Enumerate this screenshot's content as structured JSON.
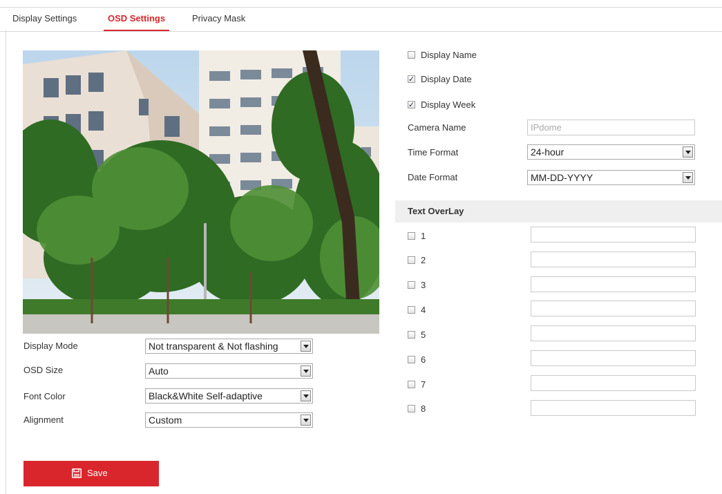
{
  "tabs": [
    {
      "label": "Display Settings",
      "active": false
    },
    {
      "label": "OSD Settings",
      "active": true
    },
    {
      "label": "Privacy Mask",
      "active": false
    }
  ],
  "left_form": {
    "display_mode": {
      "label": "Display Mode",
      "value": "Not transparent & Not flashing"
    },
    "osd_size": {
      "label": "OSD Size",
      "value": "Auto"
    },
    "font_color": {
      "label": "Font Color",
      "value": "Black&White Self-adaptive"
    },
    "alignment": {
      "label": "Alignment",
      "value": "Custom"
    }
  },
  "right_form": {
    "display_name": {
      "label": "Display Name",
      "checked": false
    },
    "display_date": {
      "label": "Display Date",
      "checked": true
    },
    "display_week": {
      "label": "Display Week",
      "checked": true
    },
    "camera_name": {
      "label": "Camera Name",
      "value": "",
      "placeholder": "IPdome"
    },
    "time_format": {
      "label": "Time Format",
      "value": "24-hour"
    },
    "date_format": {
      "label": "Date Format",
      "value": "MM-DD-YYYY"
    }
  },
  "text_overlay": {
    "title": "Text OverLay",
    "items": [
      {
        "label": "1",
        "checked": false,
        "value": ""
      },
      {
        "label": "2",
        "checked": false,
        "value": ""
      },
      {
        "label": "3",
        "checked": false,
        "value": ""
      },
      {
        "label": "4",
        "checked": false,
        "value": ""
      },
      {
        "label": "5",
        "checked": false,
        "value": ""
      },
      {
        "label": "6",
        "checked": false,
        "value": ""
      },
      {
        "label": "7",
        "checked": false,
        "value": ""
      },
      {
        "label": "8",
        "checked": false,
        "value": ""
      }
    ]
  },
  "save": {
    "label": "Save",
    "icon": "save-icon"
  },
  "colors": {
    "accent": "#d9262c",
    "header_bg": "#efefef"
  }
}
